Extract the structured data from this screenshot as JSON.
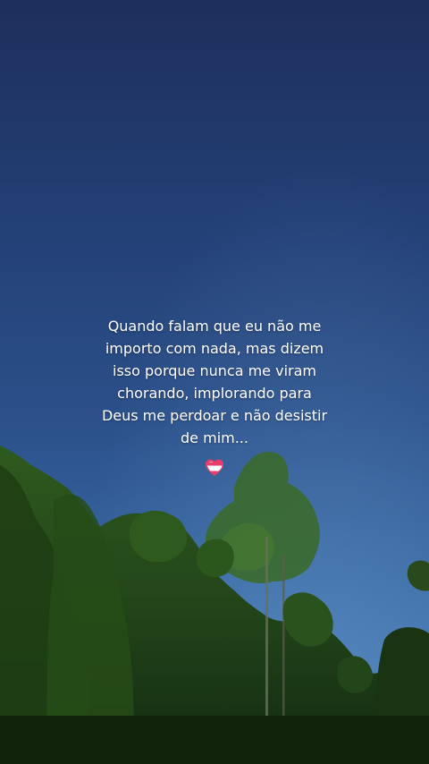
{
  "quote": {
    "lines": [
      "Quando falam que eu não me",
      "importo com nada, mas dizem",
      "isso porque nunca me viram",
      "chorando, implorando para",
      "Deus me perdoar e não desistir",
      "de mim..."
    ]
  },
  "emoji": {
    "icon": "heart-icon",
    "colors": [
      "#e83e6b",
      "#ffffff",
      "#f6a5bd"
    ]
  },
  "colors": {
    "sky_top": "#1d2f5c",
    "sky_bottom": "#4a7fb6",
    "foliage": "#1c3a14",
    "text": "#ffffff"
  }
}
